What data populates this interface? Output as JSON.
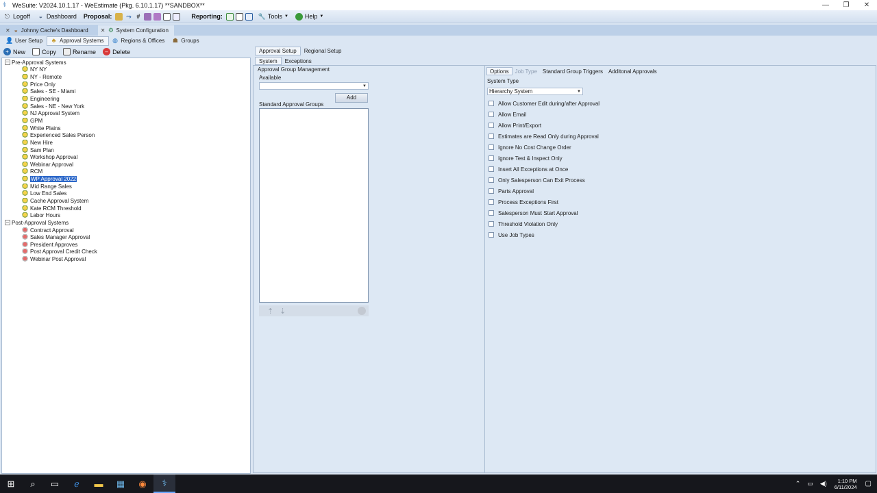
{
  "window": {
    "title": "WeSuite: V2024.10.1.17 - WeEstimate (Pkg. 6.10.1.17) **SANDBOX**",
    "minimize": "—",
    "restore": "❐",
    "close": "✕"
  },
  "menubar": {
    "logoff": "Logoff",
    "dashboard": "Dashboard",
    "proposal": "Proposal:",
    "reporting": "Reporting:",
    "tools": "Tools",
    "help": "Help"
  },
  "doc_tabs": [
    {
      "label": "Johnny Cache's Dashboard",
      "close": "✕"
    },
    {
      "label": "System Configuration",
      "close": "✕"
    }
  ],
  "sub_tabs": [
    "User Setup",
    "Approval Systems",
    "Regions & Offices",
    "Groups"
  ],
  "toolbar": {
    "new": "New",
    "copy": "Copy",
    "rename": "Rename",
    "delete": "Delete"
  },
  "tree": {
    "pre_root": "Pre-Approval Systems",
    "pre_items": [
      "NY NY",
      "NY - Remote",
      "Price Only",
      "Sales - SE - Miami",
      "Engineering",
      "Sales - NE - New York",
      "NJ Approval System",
      "GPM",
      "White Plains",
      "Experienced Sales Person",
      "New Hire",
      "Sam Plan",
      "Workshop Approval",
      "Webinar Approval",
      "RCM",
      "WP Approval 2022",
      "Mid Range Sales",
      "Low End Sales",
      "Cache Approval System",
      "Kate RCM Threshold",
      "Labor Hours"
    ],
    "selected": "WP Approval 2022",
    "post_root": "Post-Approval Systems",
    "post_items": [
      "Contract Approval",
      "Sales Manager Approval",
      "President Approves",
      "Post Approval Credit Check",
      "Webinar Post Approval"
    ]
  },
  "panel_tabs": [
    "Approval Setup",
    "Regional Setup"
  ],
  "inner_tabs": [
    "System",
    "Exceptions"
  ],
  "mid": {
    "section_title": "Approval Group Management",
    "available_label": "Available",
    "available_value": "",
    "add_button": "Add",
    "standard_groups_label": "Standard Approval Groups"
  },
  "options": {
    "tabs": [
      "Options",
      "Job Type",
      "Standard Group Triggers",
      "Additonal Approvals"
    ],
    "system_type_label": "System Type",
    "system_type_value": "Hierarchy System",
    "checkboxes": [
      "Allow Customer Edit during/after Approval",
      "Allow Email",
      "Allow Print/Export",
      "Estimates are Read Only during Approval",
      "Ignore No Cost Change Order",
      "Ignore Test & Inspect Only",
      "Insert All Exceptions at Once",
      "Only Salesperson Can Exit Process",
      "Parts Approval",
      "Process Exceptions First",
      "Salesperson Must Start Approval",
      "Threshold Violation Only",
      "Use Job Types"
    ]
  },
  "taskbar": {
    "time": "1:10 PM",
    "date": "6/11/2024"
  }
}
